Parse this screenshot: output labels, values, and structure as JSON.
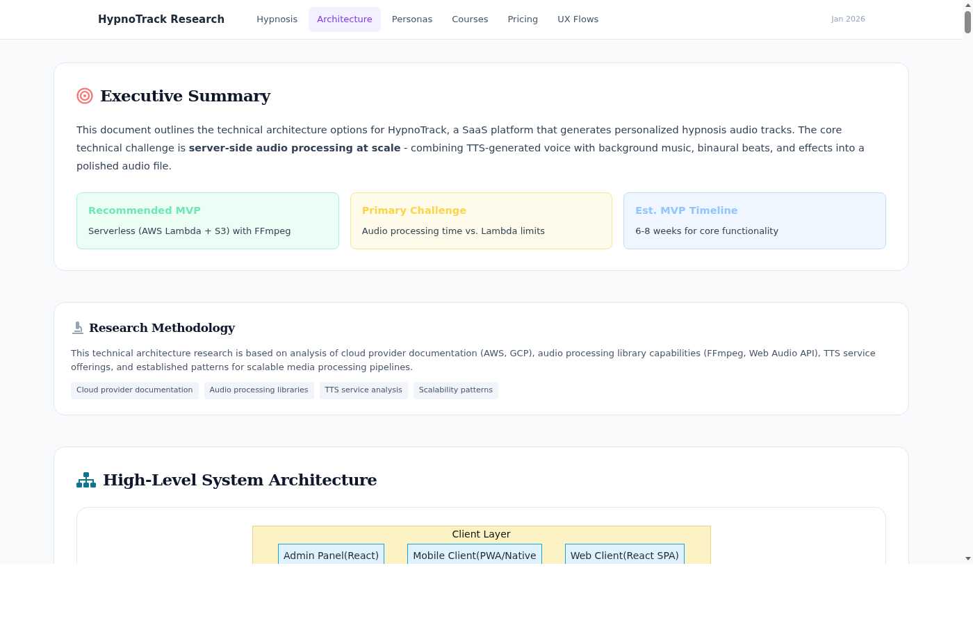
{
  "nav": {
    "brand": "HypnoTrack Research",
    "links": [
      {
        "label": "Hypnosis",
        "selected": false
      },
      {
        "label": "Architecture",
        "selected": true
      },
      {
        "label": "Personas",
        "selected": false
      },
      {
        "label": "Courses",
        "selected": false
      },
      {
        "label": "Pricing",
        "selected": false
      },
      {
        "label": "UX Flows",
        "selected": false
      }
    ],
    "date": "Jan 2026"
  },
  "summary": {
    "title": "Executive Summary",
    "text": "This document outlines the technical architecture options for HypnoTrack, a SaaS platform that generates personalized hypnosis audio tracks. The core technical challenge is **server-side audio processing at scale** - combining TTS-generated voice with background music, binaural beats, and effects into a polished audio file.",
    "cards": [
      {
        "title": "Recommended MVP",
        "text": "Serverless (AWS Lambda + S3) with FFmpeg",
        "color": "#6ee7b7"
      },
      {
        "title": "Primary Challenge",
        "text": "Audio processing time vs. Lambda limits",
        "color": "#fcd34d"
      },
      {
        "title": "Est. MVP Timeline",
        "text": "6-8 weeks for core functionality",
        "color": "#93c5fd"
      }
    ]
  },
  "methodology": {
    "title": "Research Methodology",
    "text": "This technical architecture research is based on analysis of cloud provider documentation (AWS, GCP), audio processing library capabilities (FFmpeg, Web Audio API), TTS service offerings, and established patterns for scalable media processing pipelines.",
    "tags": [
      "Cloud provider documentation",
      "Audio processing libraries",
      "TTS service analysis",
      "Scalability patterns"
    ]
  },
  "architecture": {
    "title": "High-Level System Architecture",
    "diagram": {
      "layer": "Client Layer",
      "nodes": [
        "Admin Panel(React)",
        "Mobile Client(PWA/Native",
        "Web Client(React SPA)"
      ]
    }
  }
}
